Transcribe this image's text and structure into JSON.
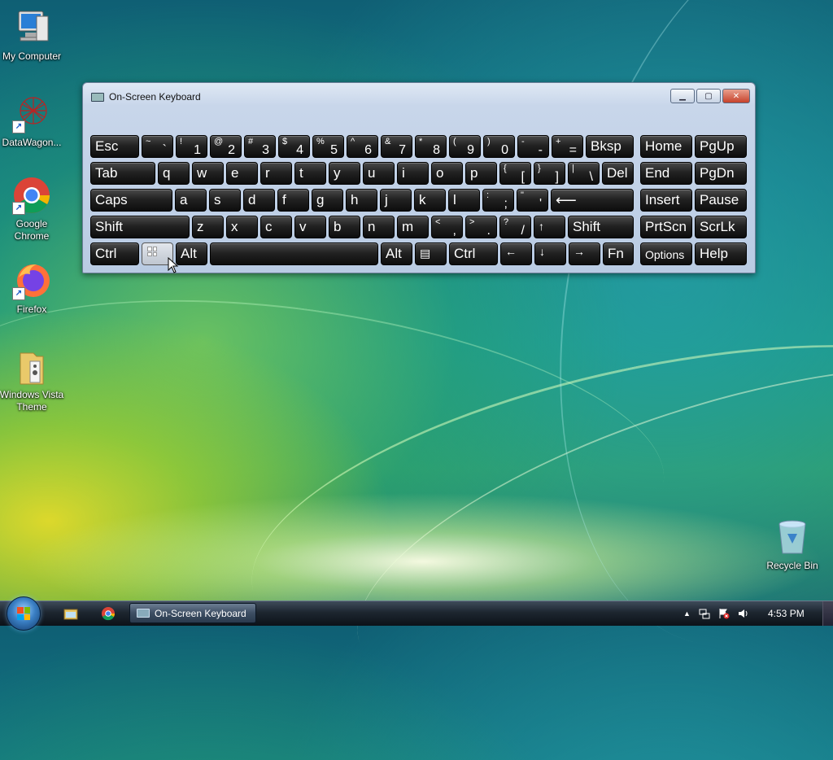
{
  "desktop": {
    "icons": [
      {
        "label": "My Computer"
      },
      {
        "label": "DataWagon..."
      },
      {
        "label": "Google Chrome"
      },
      {
        "label": "Firefox"
      },
      {
        "label": "Windows Vista Theme"
      },
      {
        "label": "Recycle Bin"
      }
    ]
  },
  "osk": {
    "title": "On-Screen Keyboard",
    "keys": {
      "esc": "Esc",
      "tilde_sub": "~",
      "tilde": "`",
      "k1_sub": "!",
      "k1": "1",
      "k2_sub": "@",
      "k2": "2",
      "k3_sub": "#",
      "k3": "3",
      "k4_sub": "$",
      "k4": "4",
      "k5_sub": "%",
      "k5": "5",
      "k6_sub": "^",
      "k6": "6",
      "k7_sub": "&",
      "k7": "7",
      "k8_sub": "*",
      "k8": "8",
      "k9_sub": "(",
      "k9": "9",
      "k0_sub": ")",
      "k0": "0",
      "minus_sub": "-",
      "minus": "-",
      "equals_sub": "+",
      "equals": "=",
      "bksp": "Bksp",
      "home": "Home",
      "pgup": "PgUp",
      "tab": "Tab",
      "q": "q",
      "w": "w",
      "e": "e",
      "r": "r",
      "t": "t",
      "y": "y",
      "u": "u",
      "i": "i",
      "o": "o",
      "p": "p",
      "lbracket_sub": "{",
      "lbracket": "[",
      "rbracket_sub": "}",
      "rbracket": "]",
      "backslash_sub": "|",
      "backslash": "\\",
      "del": "Del",
      "end": "End",
      "pgdn": "PgDn",
      "caps": "Caps",
      "a": "a",
      "s": "s",
      "d": "d",
      "f": "f",
      "g": "g",
      "h": "h",
      "j": "j",
      "k": "k",
      "l": "l",
      "semicolon_sub": ":",
      "semicolon": ";",
      "quote_sub": "\"",
      "quote": "'",
      "enter": "⟵",
      "insert": "Insert",
      "pause": "Pause",
      "shift_left": "Shift",
      "z": "z",
      "x": "x",
      "c": "c",
      "v": "v",
      "b": "b",
      "n": "n",
      "m": "m",
      "comma_sub": "<",
      "comma": ",",
      "period_sub": ">",
      "period": ".",
      "slash_sub": "?",
      "slash": "/",
      "up": "↑",
      "shift_right": "Shift",
      "prtscn": "PrtScn",
      "scrlk": "ScrLk",
      "ctrl_left": "Ctrl",
      "alt_left": "Alt",
      "space": "",
      "alt_right": "Alt",
      "menu": "▤",
      "ctrl_right": "Ctrl",
      "left": "←",
      "down": "↓",
      "right": "→",
      "fn": "Fn",
      "options": "Options",
      "help": "Help"
    }
  },
  "taskbar": {
    "active_task": "On-Screen Keyboard",
    "clock": "4:53 PM",
    "tray_arrow": "▲"
  }
}
